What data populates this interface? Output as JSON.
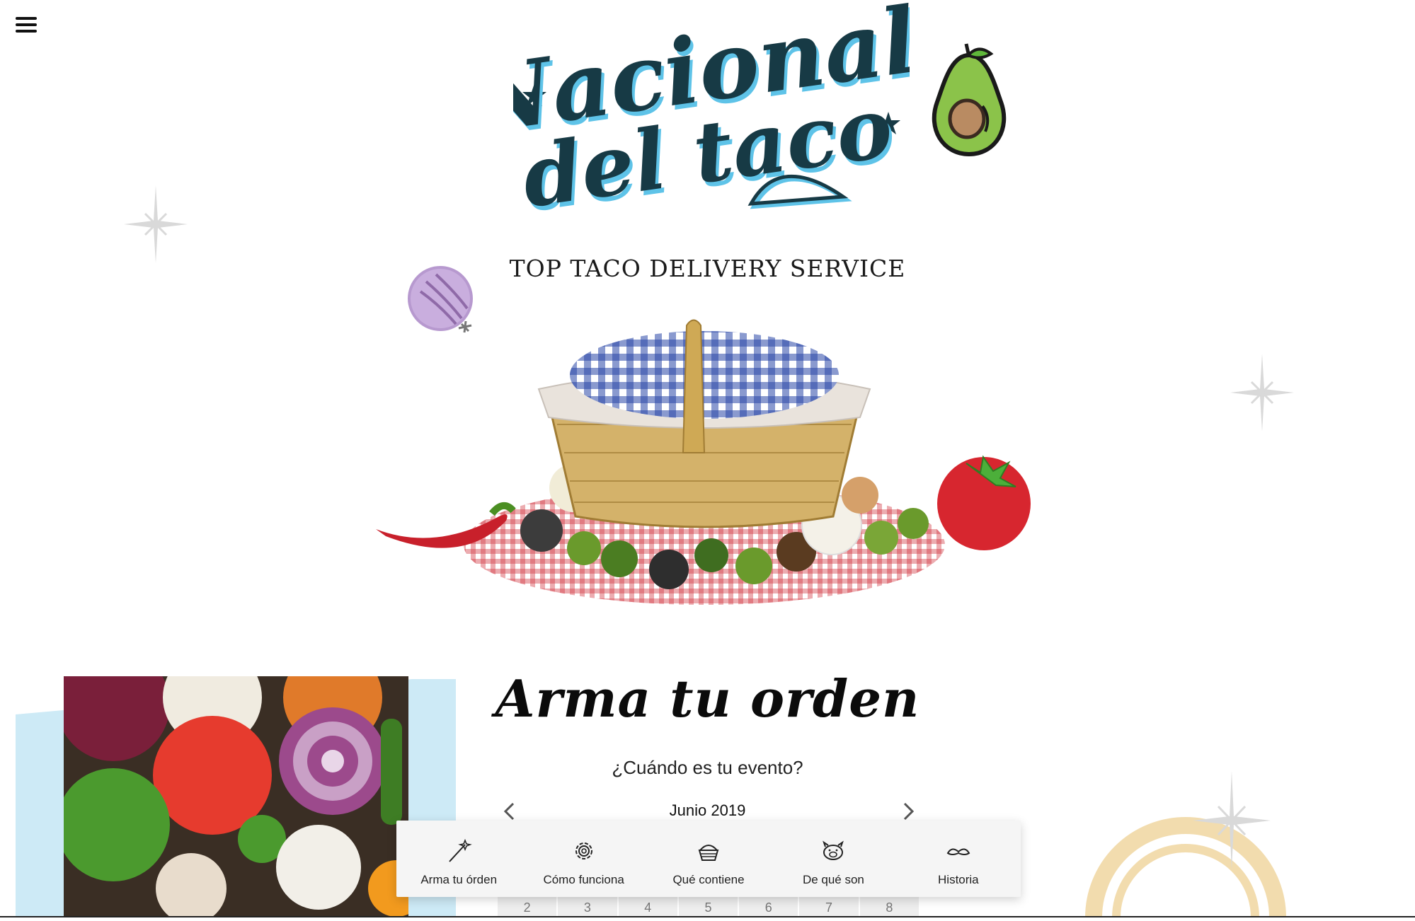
{
  "logo": {
    "line1": "Nacional",
    "line2": "del taco"
  },
  "tagline": "TOP TACO DELIVERY SERVICE",
  "order": {
    "title": "Arma tu orden",
    "question": "¿Cuándo es tu evento?",
    "month": "Junio 2019",
    "days": [
      "2",
      "3",
      "4",
      "5",
      "6",
      "7",
      "8"
    ]
  },
  "nav": {
    "items": [
      {
        "label": "Arma tu órden",
        "icon": "magic-wand-icon"
      },
      {
        "label": "Cómo funciona",
        "icon": "gear-icon"
      },
      {
        "label": "Qué contiene",
        "icon": "basket-icon"
      },
      {
        "label": "De qué son",
        "icon": "pig-icon"
      },
      {
        "label": "Historia",
        "icon": "mustache-icon"
      }
    ]
  },
  "colors": {
    "logo_ink": "#173a45",
    "logo_shadow": "#5ec3e8",
    "photo_backdrop": "#cdeaf6",
    "rainbow": "#f2dcae",
    "nav_bg": "#f5f5f5"
  }
}
